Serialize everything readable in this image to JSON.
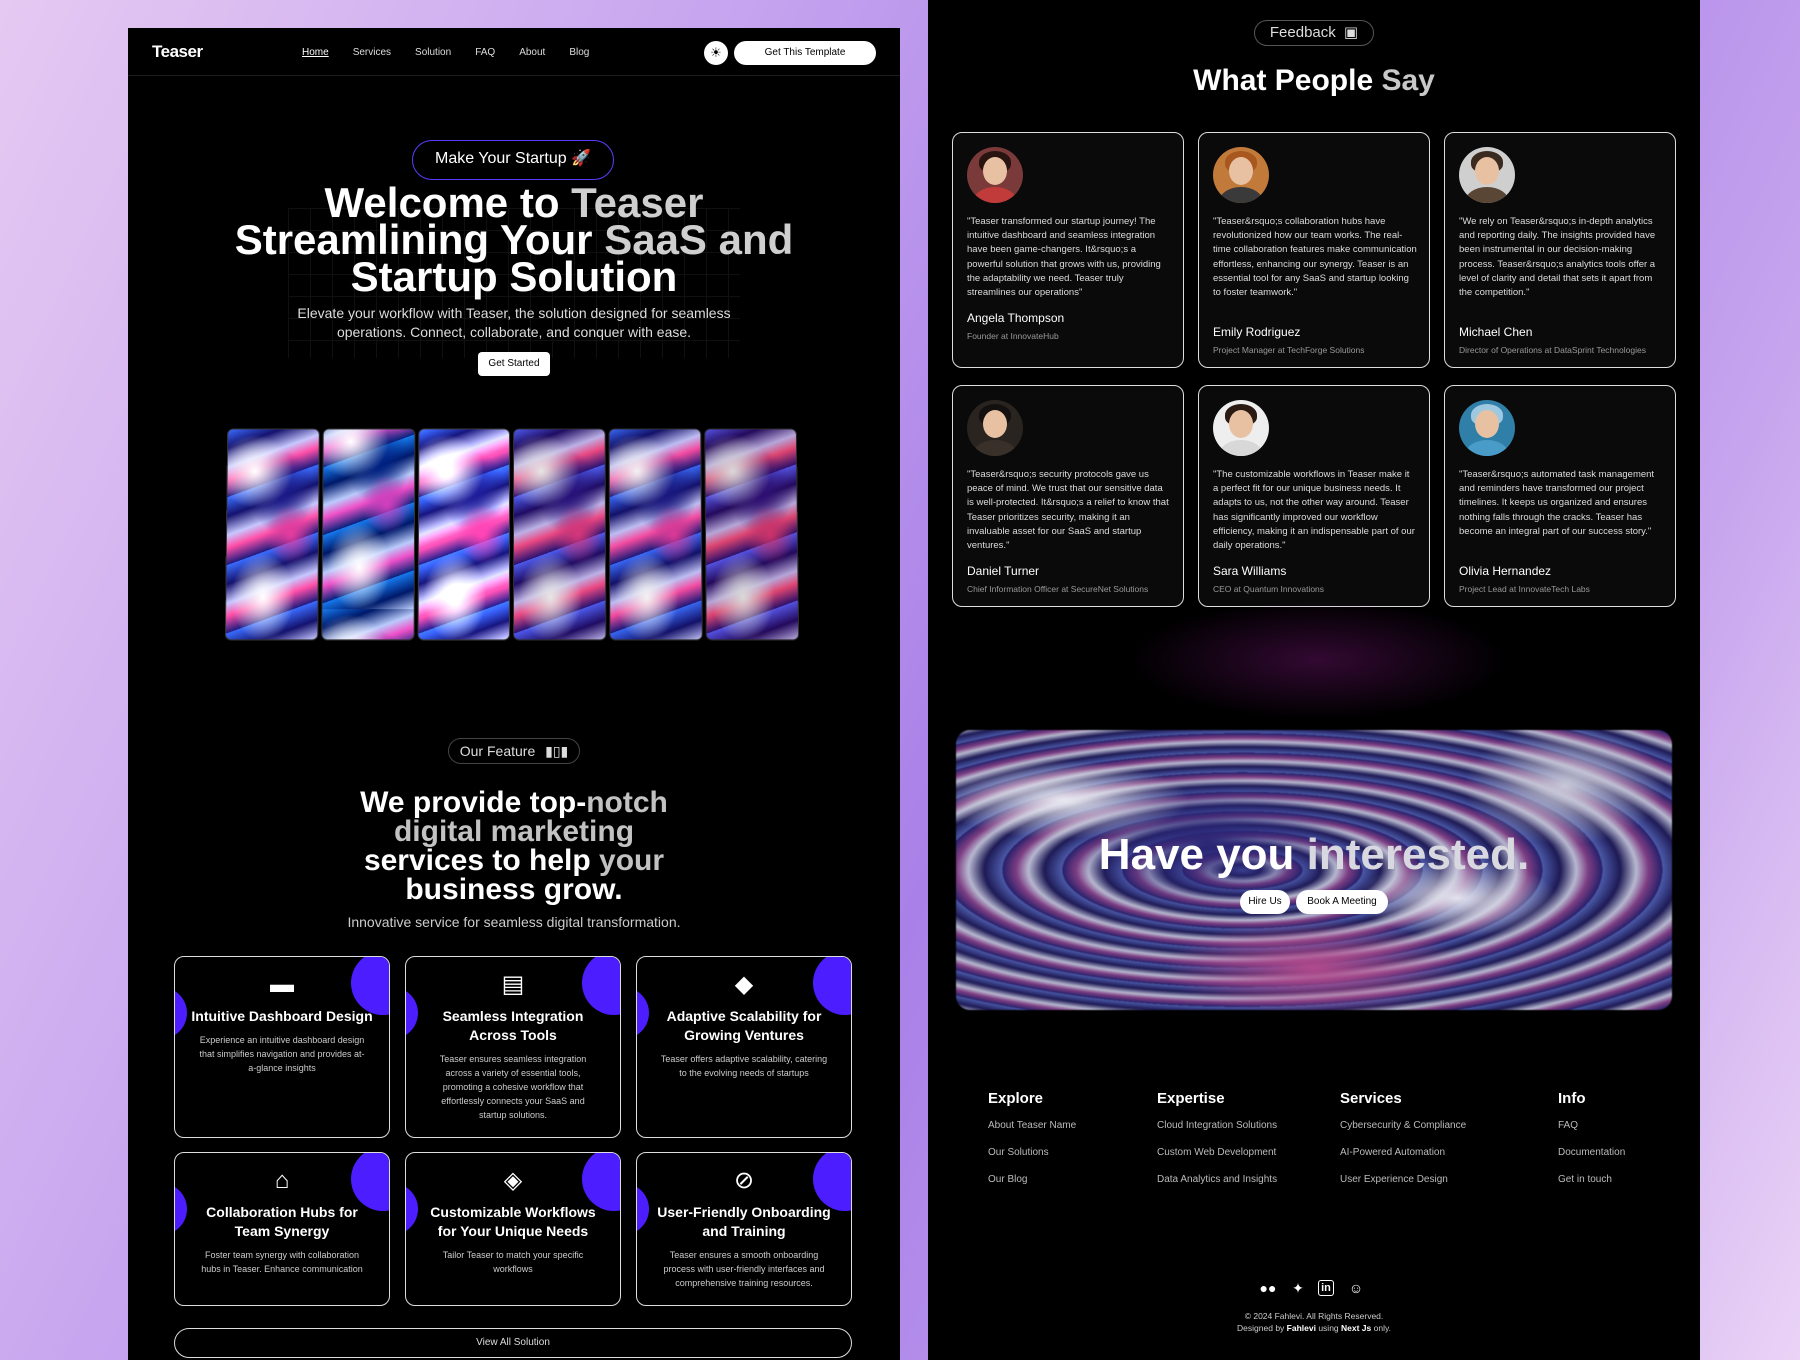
{
  "nav": {
    "logo": "Teaser",
    "links": [
      "Home",
      "Services",
      "Solution",
      "FAQ",
      "About",
      "Blog"
    ],
    "theme_icon": "sun-icon",
    "cta": "Get This Template"
  },
  "hero": {
    "pill": "Make Your Startup 🚀",
    "title_line1_a": "Welcome to ",
    "title_line1_b": "Teaser",
    "title_line2_a": "Streamlining Your ",
    "title_line2_b": "SaaS and",
    "title_line3": "Startup Solution",
    "subtitle": "Elevate your workflow with Teaser, the solution designed for seamless operations. Connect, collaborate, and conquer with ease.",
    "button": "Get Started"
  },
  "features": {
    "pill": "Our Feature",
    "pill_icon": "bars-icon",
    "title_a": "We provide top-",
    "title_b": "notch",
    "title_c": "digital marketing",
    "title_d": "services to help ",
    "title_e": "your",
    "title_f": "business grow.",
    "subtitle": "Innovative service for seamless digital transformation.",
    "cards": [
      {
        "icon": "dashboard-icon",
        "glyph": "▬",
        "title": "Intuitive Dashboard Design",
        "desc": "Experience an intuitive dashboard design that simplifies navigation and provides at-a-glance insights"
      },
      {
        "icon": "document-icon",
        "glyph": "▤",
        "title": "Seamless Integration Across Tools",
        "desc": "Teaser ensures seamless integration across a variety of essential tools, promoting a cohesive workflow that effortlessly connects your SaaS and startup solutions."
      },
      {
        "icon": "diamond-icon",
        "glyph": "◆",
        "title": "Adaptive Scalability for Growing Ventures",
        "desc": "Teaser offers adaptive scalability, catering to the evolving needs of startups"
      },
      {
        "icon": "store-icon",
        "glyph": "⌂",
        "title": "Collaboration Hubs for Team Synergy",
        "desc": "Foster team synergy with collaboration hubs in Teaser. Enhance communication"
      },
      {
        "icon": "graduation-cap-icon",
        "glyph": "◈",
        "title": "Customizable Workflows for Your Unique Needs",
        "desc": "Tailor Teaser to match your specific workflows"
      },
      {
        "icon": "compass-icon",
        "glyph": "⊘",
        "title": "User-Friendly Onboarding and Training",
        "desc": "Teaser ensures a smooth onboarding process with user-friendly interfaces and comprehensive training resources."
      }
    ],
    "view_all": "View All Solution"
  },
  "testimonials": {
    "pill": "Feedback",
    "pill_icon": "chat-icon",
    "title_a": "What People ",
    "title_b": "Say",
    "items": [
      {
        "quote": "\"Teaser transformed our startup journey! The intuitive dashboard and seamless integration have been game-changers. It&rsquo;s a powerful solution that grows with us, providing the adaptability we need. Teaser truly streamlines our operations\"",
        "name": "Angela Thompson",
        "role": "Founder at InnovateHub",
        "bg": "#7a3a3a",
        "hair": "#2a1410",
        "shirt": "#c23b3b"
      },
      {
        "quote": "\"Teaser&rsquo;s collaboration hubs have revolutionized how our team works. The real-time collaboration features make communication effortless, enhancing our synergy. Teaser is an essential tool for any SaaS and startup looking to foster teamwork.\"",
        "name": "Emily Rodriguez",
        "role": "Project Manager at TechForge Solutions",
        "bg": "#c27a3a",
        "hair": "#a8571f",
        "shirt": "#3a3a3a"
      },
      {
        "quote": "\"We rely on Teaser&rsquo;s in-depth analytics and reporting daily. The insights provided have been instrumental in our decision-making process. Teaser&rsquo;s analytics tools offer a level of clarity and detail that sets it apart from the competition.\"",
        "name": "Michael Chen",
        "role": "Director of Operations at DataSprint Technologies",
        "bg": "#cfcfcf",
        "hair": "#3b2a1f",
        "shirt": "#5a4634"
      },
      {
        "quote": "\"Teaser&rsquo;s security protocols gave us peace of mind. We trust that our sensitive data is well-protected. It&rsquo;s a relief to know that Teaser prioritizes security, making it an invaluable asset for our SaaS and startup ventures.\"",
        "name": "Daniel Turner",
        "role": "Chief Information Officer at SecureNet Solutions",
        "bg": "#2a2420",
        "hair": "#141010",
        "shirt": "#3a302a"
      },
      {
        "quote": "\"The customizable workflows in Teaser make it a perfect fit for our unique business needs. It adapts to us, not the other way around. Teaser has significantly improved our workflow efficiency, making it an indispensable part of our daily operations.\"",
        "name": "Sara Williams",
        "role": "CEO at Quantum Innovations",
        "bg": "#eeeeee",
        "hair": "#2a1a12",
        "shirt": "#d8d8d8"
      },
      {
        "quote": "\"Teaser&rsquo;s automated task management and reminders have transformed our project timelines. It keeps us organized and ensures nothing falls through the cracks. Teaser has become an integral part of our success story.\"",
        "name": "Olivia Hernandez",
        "role": "Project Lead at InnovateTech Labs",
        "bg": "#2f7fa8",
        "hair": "#9ec8e0",
        "shirt": "#4a9cc8"
      }
    ]
  },
  "cta": {
    "title_a": "Have you ",
    "title_b": "interested.",
    "hire": "Hire Us",
    "meeting": "Book A Meeting"
  },
  "footer": {
    "columns": [
      {
        "heading": "Explore",
        "links": [
          "About Teaser Name",
          "Our Solutions",
          "Our Blog"
        ]
      },
      {
        "heading": "Expertise",
        "links": [
          "Cloud Integration Solutions",
          "Custom Web Development",
          "Data Analytics and Insights"
        ]
      },
      {
        "heading": "Services",
        "links": [
          "Cybersecurity & Compliance",
          "AI-Powered Automation",
          "User Experience Design"
        ]
      },
      {
        "heading": "Info",
        "links": [
          "FAQ",
          "Documentation",
          "Get in touch"
        ]
      }
    ],
    "socials": [
      {
        "icon": "medium-icon",
        "glyph": "●●"
      },
      {
        "icon": "twitter-icon",
        "glyph": "🐦"
      },
      {
        "icon": "linkedin-icon",
        "glyph": "in"
      },
      {
        "icon": "discord-icon",
        "glyph": "☺"
      }
    ],
    "copyright": "© 2024 Fahlevi. All Rights Reserved.",
    "designed_prefix": "Designed by ",
    "designer": "Fahlevi",
    "designed_mid": " using ",
    "tech": "Next Js",
    "designed_suffix": " only."
  }
}
